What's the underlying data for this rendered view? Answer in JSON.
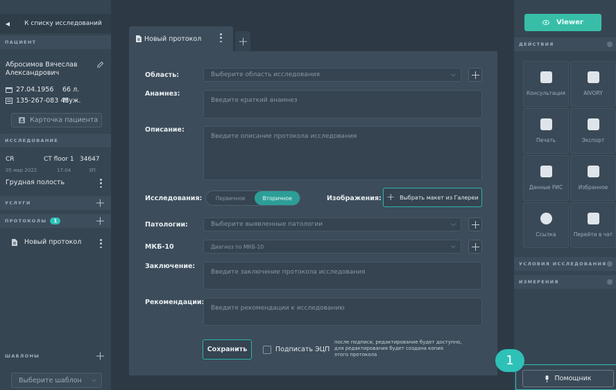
{
  "left": {
    "back_label": "К списку исследований",
    "patient_header": "ПАЦИЕНТ",
    "patient_name_line1": "Абросимов Вячеслав",
    "patient_name_line2": "Александрович",
    "birth_date": "27.04.1956",
    "age": "66 л.",
    "snils": "135-267-083 45",
    "gender": "Муж.",
    "patient_card_button": "Карточка пациента",
    "study_header": "ИССЛЕДОВАНИЕ",
    "study_modality": "CR",
    "study_device": "CT floor 1",
    "study_number": "34647",
    "study_date": "05 мар 2022",
    "study_time": "17:04",
    "study_code": "ЗП",
    "study_region": "Грудная полость",
    "services_header": "УСЛУГИ",
    "protocols_header": "ПРОТОКОЛЫ",
    "protocols_count": "1",
    "protocol_item": "Новый протокол",
    "templates_header": "ШАБЛОНЫ",
    "template_select_placeholder": "Выберите шаблон"
  },
  "center": {
    "tab_label": "Новый протокол",
    "fields": {
      "area_label": "Область:",
      "area_placeholder": "Выберите область исследования",
      "anamnesis_label": "Анамнез:",
      "anamnesis_placeholder": "Введите краткий анамнез",
      "description_label": "Описание:",
      "description_placeholder": "Введите описание протокола исследования",
      "studies_label": "Исследования:",
      "studies_options": [
        "Первичное",
        "Вторичное"
      ],
      "studies_selected": "Вторичное",
      "images_label": "Изображения:",
      "gallery_button": "Выбрать макет из Галереи",
      "pathology_label": "Патологии:",
      "pathology_placeholder": "Выберите выявленные патологии",
      "mkb_label": "МКБ-10",
      "mkb_placeholder": "Диагноз по МКБ-10",
      "conclusion_label": "Заключение:",
      "conclusion_placeholder": "Введите заключение протокола исследования",
      "recommendations_label": "Рекомендации:",
      "recommendations_placeholder": "Введите рекомендации к исследованию"
    },
    "save_button": "Сохранить",
    "sign_label": "Подписать ЭЦП",
    "sign_note_line1": "после подписи, редактирование будет доступно,",
    "sign_note_line2": "для редактирования будет создана копия",
    "sign_note_line3": "этого протокола"
  },
  "right": {
    "viewer_button": "Viewer",
    "actions_header": "ДЕЙСТВИЯ",
    "actions": [
      {
        "label": "Консультация",
        "icon": "consultation-icon"
      },
      {
        "label": "AIVORY",
        "icon": "chip-icon"
      },
      {
        "label": "Печать",
        "icon": "print-icon"
      },
      {
        "label": "Экспорт",
        "icon": "export-icon"
      },
      {
        "label": "Данные РИС",
        "icon": "settings-icon"
      },
      {
        "label": "Избранное",
        "icon": "star-icon"
      },
      {
        "label": "Ссылка",
        "icon": "share-icon"
      },
      {
        "label": "Перейти в чат",
        "icon": "chat-icon"
      }
    ],
    "conditions_header": "УСЛОВИЯ ИССЛЕДОВАНИЯ",
    "measurements_header": "ИЗМЕРЕНИЯ",
    "assistant_button": "Помощник"
  },
  "overlay_badge": "1",
  "colors": {
    "accent": "#2ec1b8",
    "viewer": "#38bea8",
    "panel": "#3c4c5a"
  }
}
